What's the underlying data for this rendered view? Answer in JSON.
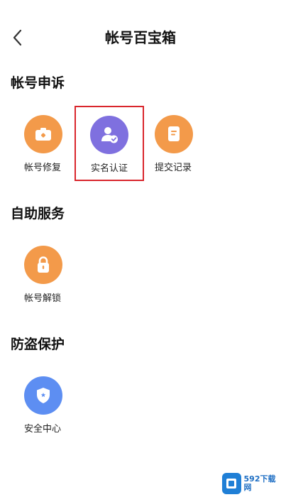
{
  "header": {
    "title": "帐号百宝箱",
    "back_icon": "chevron-left-icon"
  },
  "sections": [
    {
      "title": "帐号申诉",
      "items": [
        {
          "label": "帐号修复",
          "icon": "camera-briefcase-icon",
          "color": "#f39a4a"
        },
        {
          "label": "实名认证",
          "icon": "user-verified-icon",
          "color": "#7f70df",
          "highlighted": true
        },
        {
          "label": "提交记录",
          "icon": "document-icon",
          "color": "#f39a4a"
        }
      ]
    },
    {
      "title": "自助服务",
      "items": [
        {
          "label": "帐号解锁",
          "icon": "lock-icon",
          "color": "#f39a4a"
        }
      ]
    },
    {
      "title": "防盗保护",
      "items": [
        {
          "label": "安全中心",
          "icon": "shield-icon",
          "color": "#5d8ef2"
        }
      ]
    }
  ],
  "watermark": {
    "text": "592下载网",
    "color": "#1f7fd6"
  },
  "highlight_color": "#d9262c"
}
